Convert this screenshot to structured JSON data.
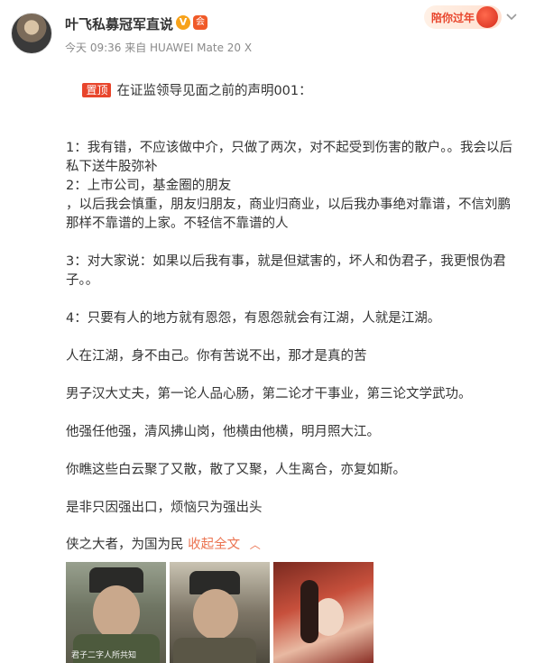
{
  "post": {
    "username": "叶飞私募冠军直说",
    "vip_badge": "V",
    "member_badge": "会",
    "meta": "今天 09:36 来自 HUAWEI Mate 20 X",
    "festival_label": "陪你过年",
    "pin_label": "置顶",
    "lines": [
      "在证监领导见面之前的声明001：",
      "",
      "1：我有错，不应该做中介，只做了两次，对不起受到伤害的散户。。我会以后私下送牛股弥补",
      "2：上市公司，基金圈的朋友",
      "，以后我会慎重，朋友归朋友，商业归商业，以后我办事绝对靠谱，不信刘鹏那样不靠谱的上家。不轻信不靠谱的人",
      "",
      "3：对大家说：如果以后我有事，就是但斌害的，坏人和伪君子，我更恨伪君子。。",
      "",
      "4：只要有人的地方就有恩怨，有恩怨就会有江湖，人就是江湖。",
      "",
      "人在江湖，身不由己。你有苦说不出，那才是真的苦",
      "",
      "男子汉大丈夫，第一论人品心肠，第二论才干事业，第三论文学武功。",
      "",
      "他强任他强，清风拂山岗，他横由他横，明月照大江。",
      "",
      "你瞧这些白云聚了又散，散了又聚，人生离合，亦复如斯。",
      "",
      "是非只因强出口，烦恼只为强出头"
    ],
    "last_line": "侠之大者，为国为民",
    "fold_label": "收起全文",
    "image_caption": "君子二字人所共知"
  },
  "colors": {
    "accent": "#eb7350",
    "pin_bg": "#e8452c",
    "meta": "#8a8a8a"
  },
  "icons": [
    "avatar",
    "vip-icon",
    "member-icon",
    "lantern-icon",
    "chevron-down-icon",
    "chevron-up-icon"
  ]
}
